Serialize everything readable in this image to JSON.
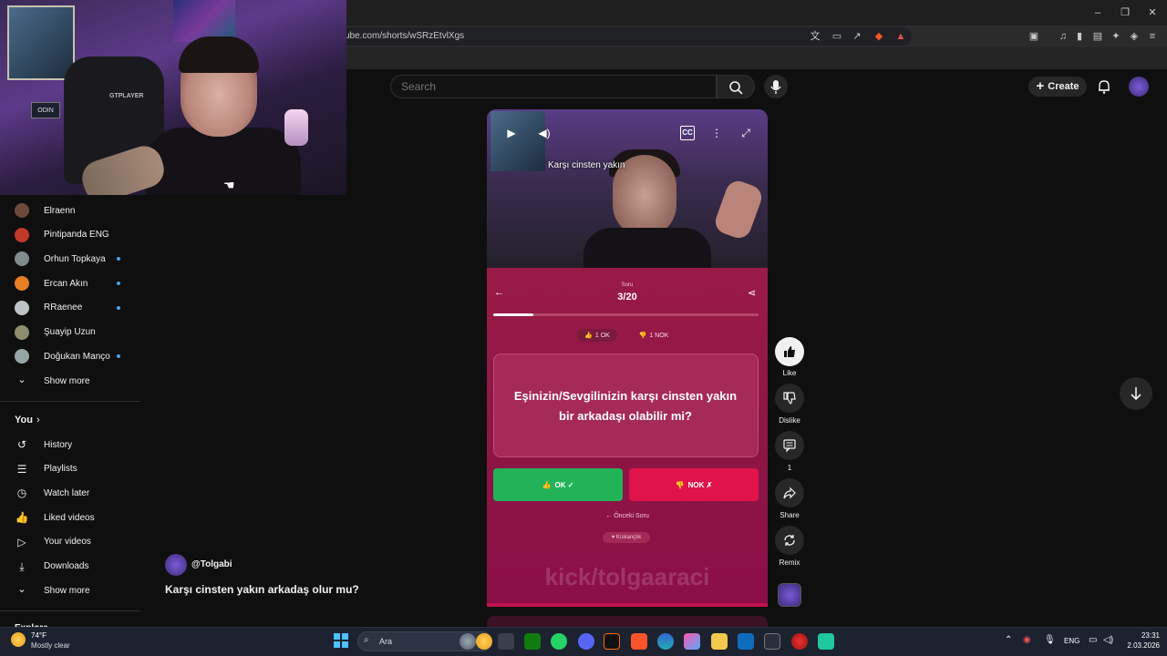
{
  "browser": {
    "url": "ube.com/shorts/wSRzEtvlXgs"
  },
  "header": {
    "search_placeholder": "Search",
    "create_label": "Create"
  },
  "sidebar": {
    "subscriptions": [
      {
        "name": "Elraenn",
        "new": false,
        "color": "#6b4a3a"
      },
      {
        "name": "Pintipanda ENG",
        "new": false,
        "color": "#c0392b"
      },
      {
        "name": "Orhun Topkaya",
        "new": true,
        "color": "#7f8c8d"
      },
      {
        "name": "Ercan Akın",
        "new": true,
        "color": "#e67e22"
      },
      {
        "name": "RRaenee",
        "new": true,
        "color": "#bdc3c7"
      },
      {
        "name": "Şuayip Uzun",
        "new": false,
        "color": "#8e8e6e"
      },
      {
        "name": "Doğukan Manço",
        "new": true,
        "color": "#95a5a6"
      }
    ],
    "show_more_1": "Show more",
    "you_label": "You",
    "you_items": [
      {
        "label": "History",
        "icon": "history-icon"
      },
      {
        "label": "Playlists",
        "icon": "playlists-icon"
      },
      {
        "label": "Watch later",
        "icon": "watch-later-icon"
      },
      {
        "label": "Liked videos",
        "icon": "liked-videos-icon"
      },
      {
        "label": "Your videos",
        "icon": "your-videos-icon"
      },
      {
        "label": "Downloads",
        "icon": "downloads-icon"
      }
    ],
    "show_more_2": "Show more",
    "explore_label": "Explore"
  },
  "short": {
    "overlay_title": "Karşı cinsten yakın",
    "channel": "@Tolgabi",
    "title": "Karşı cinsten yakın arkadaş olur mu?"
  },
  "quiz": {
    "soru_label": "Soru",
    "counter": "3/20",
    "progress_fraction": 0.15,
    "ok_count": "1 OK",
    "nok_count": "1 NOK",
    "question": "Eşinizin/Sevgilinizin karşı cinsten yakın bir arkadaşı olabilir mi?",
    "ok_button": "OK ✓",
    "nok_button": "NOK ✗",
    "prev_label": "← Önceki Soru",
    "tag": "♥ Kıskançlık",
    "watermark": "kick/tolgaaraci",
    "ok_color": "#22b358",
    "nok_color": "#e0134a",
    "accent": "#9a1a47"
  },
  "actions": {
    "like": "Like",
    "dislike": "Dislike",
    "comments": "1",
    "share": "Share",
    "remix": "Remix"
  },
  "webcam": {
    "chair_logo": "GTPLAYER",
    "poster_text": "ODIN"
  },
  "taskbar": {
    "temperature": "74°F",
    "weather": "Mostly clear",
    "search": "Ara",
    "language": "ENG",
    "time": "23:31",
    "date": "2.03.2026"
  }
}
